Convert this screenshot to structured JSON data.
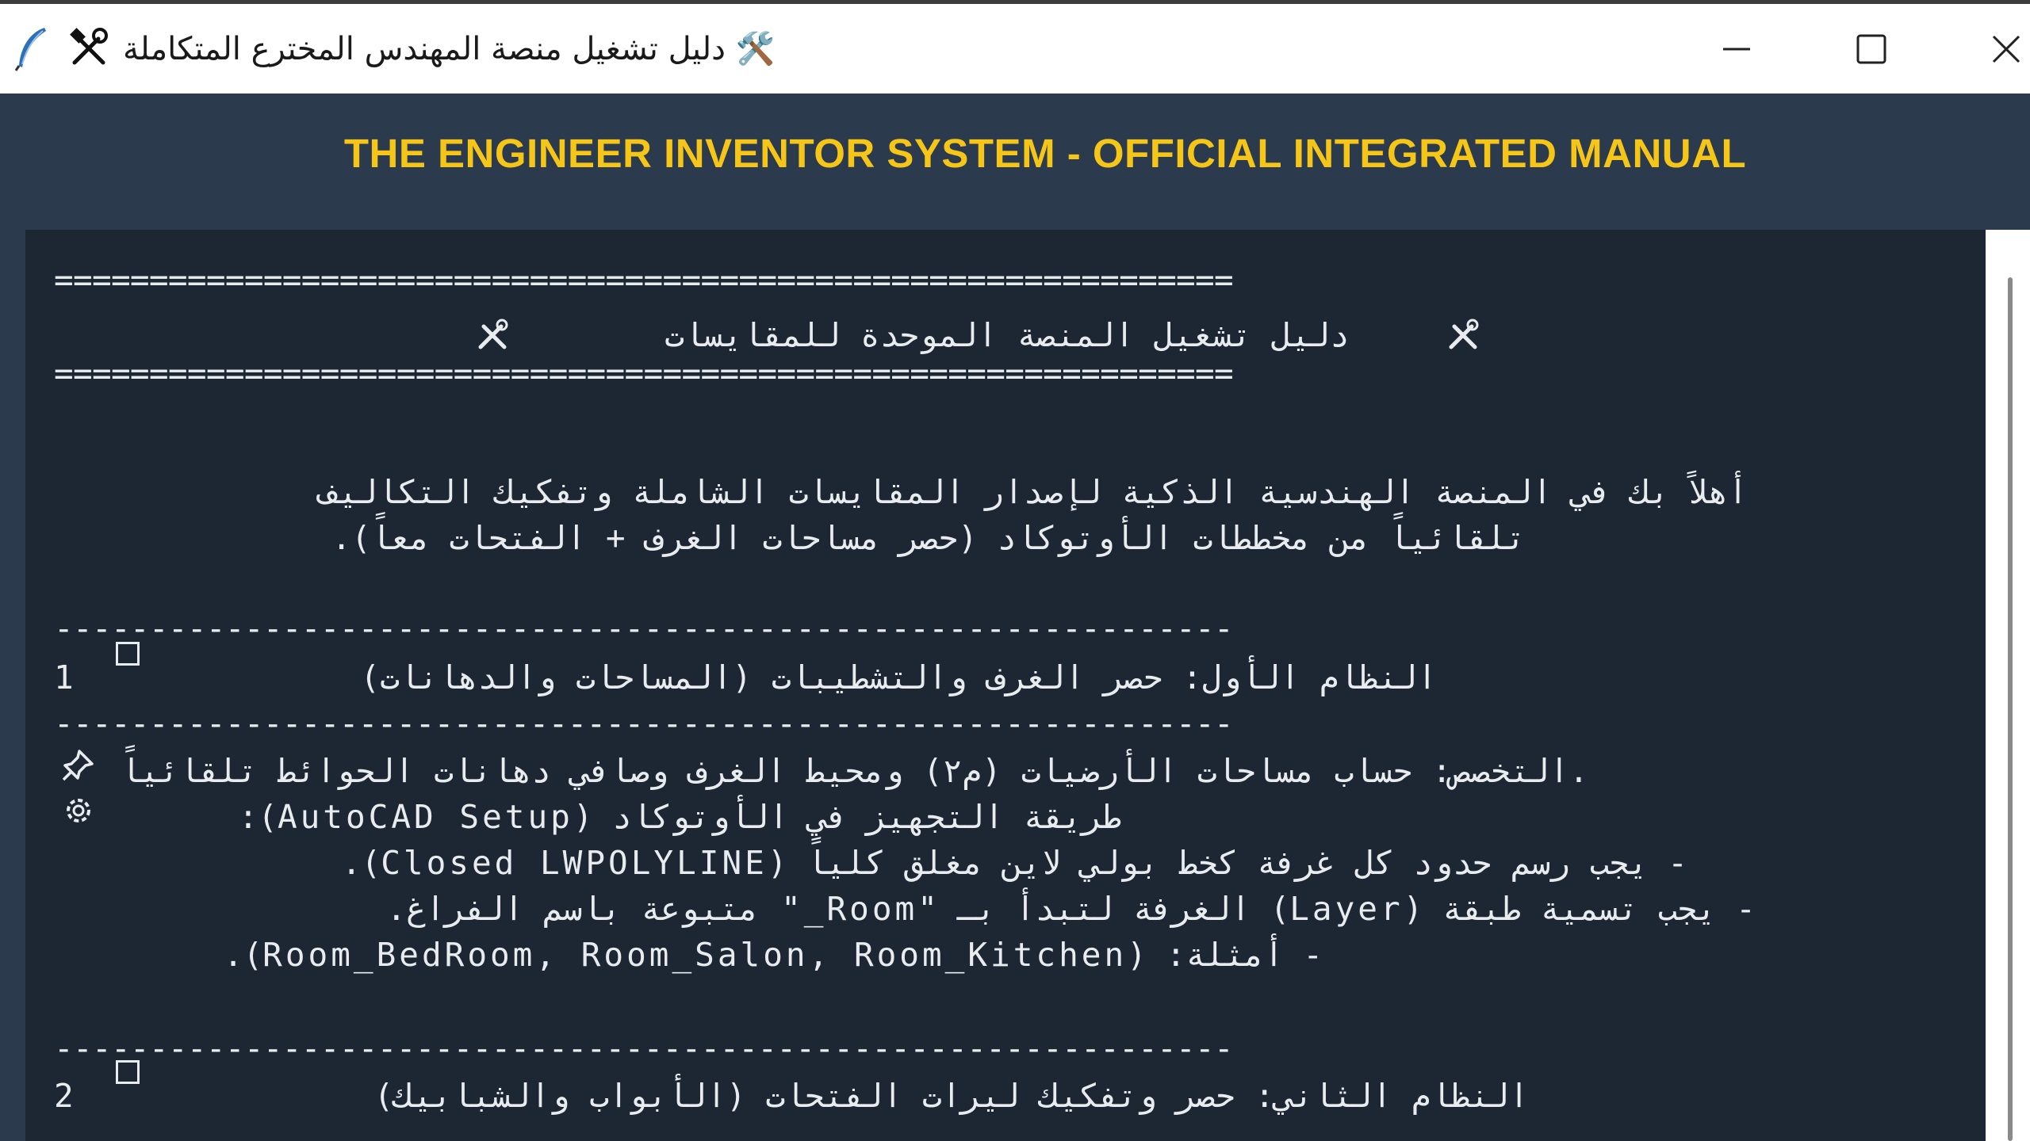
{
  "window": {
    "title": "🛠️ دليل تشغيل منصة المهندس المخترع المتكاملة",
    "app_icon": "feather-icon",
    "title_icon": "tools-icon",
    "controls": [
      "minimize-icon",
      "maximize-icon",
      "close-icon"
    ]
  },
  "header": {
    "title": "THE ENGINEER INVENTOR SYSTEM - OFFICIAL INTEGRATED MANUAL",
    "title_color": "#f5c518",
    "background": "#2b3a4d"
  },
  "doc": {
    "rule_double": "==============================================================",
    "rule_single": "--------------------------------------------------------------",
    "heading": "دليل تشغيل المنصة الموحدة للمقايسات",
    "intro_line1": "أهلاً بك في المنصة الهندسية الذكية لإصدار المقايسات الشاملة وتفكيك التكاليف",
    "intro_line2": "تلقائياً من مخططات الأوتوكاد (حصر مساحات الغرف + الفتحات معاً).",
    "section1": {
      "number": "1",
      "title": "النظام الأول: حصر الغرف والتشطيبات (المساحات والدهانات)",
      "specialty": ".التخصص: حساب مساحات الأرضيات (م٢) ومحيط الغرف وصافي دهانات الحوائط تلقائياً",
      "setup_title": "طريقة التجهيز في الأوتوكاد (AutoCAD Setup):",
      "bullets": [
        "- يجب رسم حدود كل غرفة كخط بولي لاين مغلق كلياً (Closed LWPOLYLINE).",
        "- يجب تسمية طبقة (Layer) الغرفة لتبدأ بـ \"Room_\" متبوعة باسم الفراغ.",
        "- أمثلة: (Room_BedRoom, Room_Salon, Room_Kitchen)."
      ]
    },
    "section2": {
      "number": "2",
      "title": "النظام الثاني: حصر وتفكيك ليرات الفتحات (الأبواب والشبابيك)"
    }
  },
  "icons": {
    "heading_left": "tools-icon",
    "heading_right": "tools-icon",
    "section_box": "checkbox-icon",
    "specialty_pin": "pushpin-icon",
    "setup_gear": "gear-icon"
  }
}
